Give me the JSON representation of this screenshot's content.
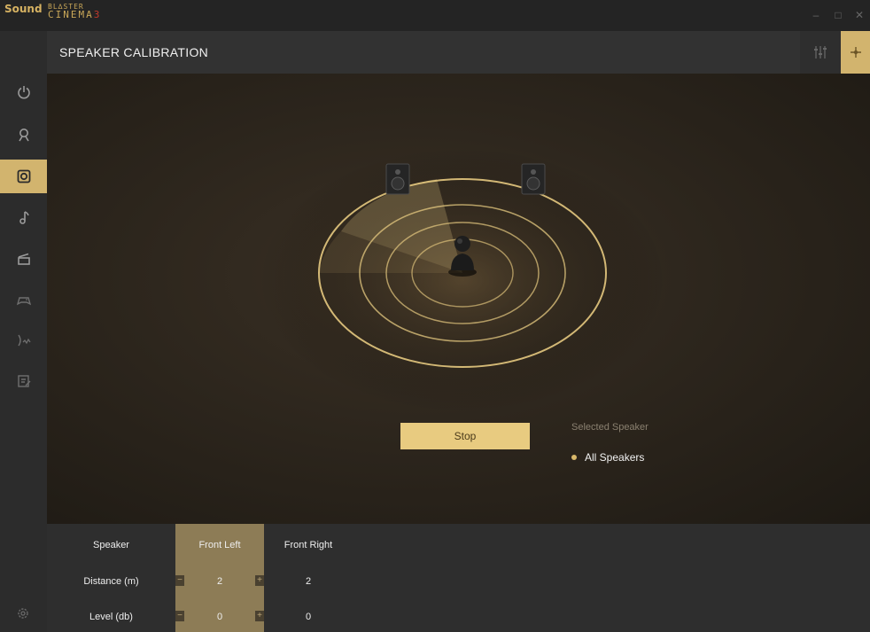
{
  "app": {
    "logo_sound": "Sound",
    "logo_blaster": "BL∆STER",
    "logo_cinema": "CINEMA",
    "logo_version": "3"
  },
  "window_controls": {
    "minimize": "–",
    "maximize": "□",
    "close": "✕"
  },
  "header": {
    "title": "SPEAKER CALIBRATION"
  },
  "sidebar": {
    "items": [
      {
        "icon": "power-icon"
      },
      {
        "icon": "user-profile-icon"
      },
      {
        "icon": "speaker-icon",
        "active": true
      },
      {
        "icon": "music-note-icon"
      },
      {
        "icon": "movie-clapper-icon"
      },
      {
        "icon": "gamepad-icon"
      },
      {
        "icon": "voice-icon"
      },
      {
        "icon": "edit-icon"
      }
    ],
    "settings_icon": "gear-icon"
  },
  "calibration": {
    "stop_label": "Stop",
    "selected_speaker_heading": "Selected Speaker",
    "selected_speaker_value": "All Speakers"
  },
  "table": {
    "speaker_label": "Speaker",
    "columns": [
      "Front Left",
      "Front Right"
    ],
    "distance_label": "Distance (m)",
    "distance_values": [
      "2",
      "2"
    ],
    "level_label": "Level (db)",
    "level_values": [
      "0",
      "0"
    ],
    "minus": "−",
    "plus": "+"
  },
  "colors": {
    "accent": "#d2b46e",
    "button": "#e8cb80",
    "stage_dark": "#1e1a14",
    "panel": "#2e2e2e"
  }
}
